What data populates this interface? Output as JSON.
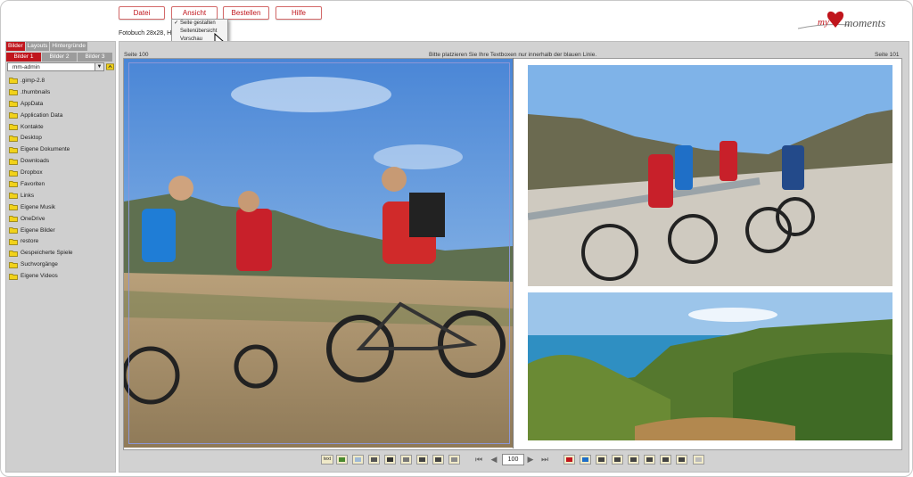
{
  "menu": {
    "items": [
      {
        "label": "Datei"
      },
      {
        "label": "Ansicht"
      },
      {
        "label": "Bestellen"
      },
      {
        "label": "Hilfe"
      }
    ],
    "dropdown": [
      {
        "label": "Seite gestalten",
        "checked": true
      },
      {
        "label": "Seitenübersicht",
        "checked": false
      },
      {
        "label": "Vorschau",
        "checked": false
      }
    ]
  },
  "document": {
    "subtitle": "Fotobuch 28x28, H"
  },
  "logo": {
    "text_my": "my",
    "text_moments": "moments",
    "heart_color": "#c0151c"
  },
  "sidebar": {
    "tabs": [
      "Bilder",
      "Layouts",
      "Hintergründe"
    ],
    "subtabs": [
      "Bilder 1",
      "Bilder 2",
      "Bilder 3"
    ],
    "user_select": "mm-admin",
    "folders": [
      ".gimp-2.8",
      ".thumbnails",
      "AppData",
      "Application Data",
      "Kontakte",
      "Desktop",
      "Eigene Dokumente",
      "Downloads",
      "Dropbox",
      "Favoriten",
      "Links",
      "Eigene Musik",
      "OneDrive",
      "Eigene Bilder",
      "restore",
      "Gespeicherte Spiele",
      "Suchvorgänge",
      "Eigene Videos"
    ]
  },
  "editor": {
    "left_page": "Seite 100",
    "right_page": "Seite 101",
    "hint": "Bitte platzieren Sie Ihre Textboxen nur innerhalb der blauen Linie.",
    "current_page": "100"
  },
  "toolbar": {
    "text_tool": "text"
  },
  "colors": {
    "accent": "#c0151c",
    "guide": "#8b96d6",
    "panel": "#d2d2d2"
  }
}
